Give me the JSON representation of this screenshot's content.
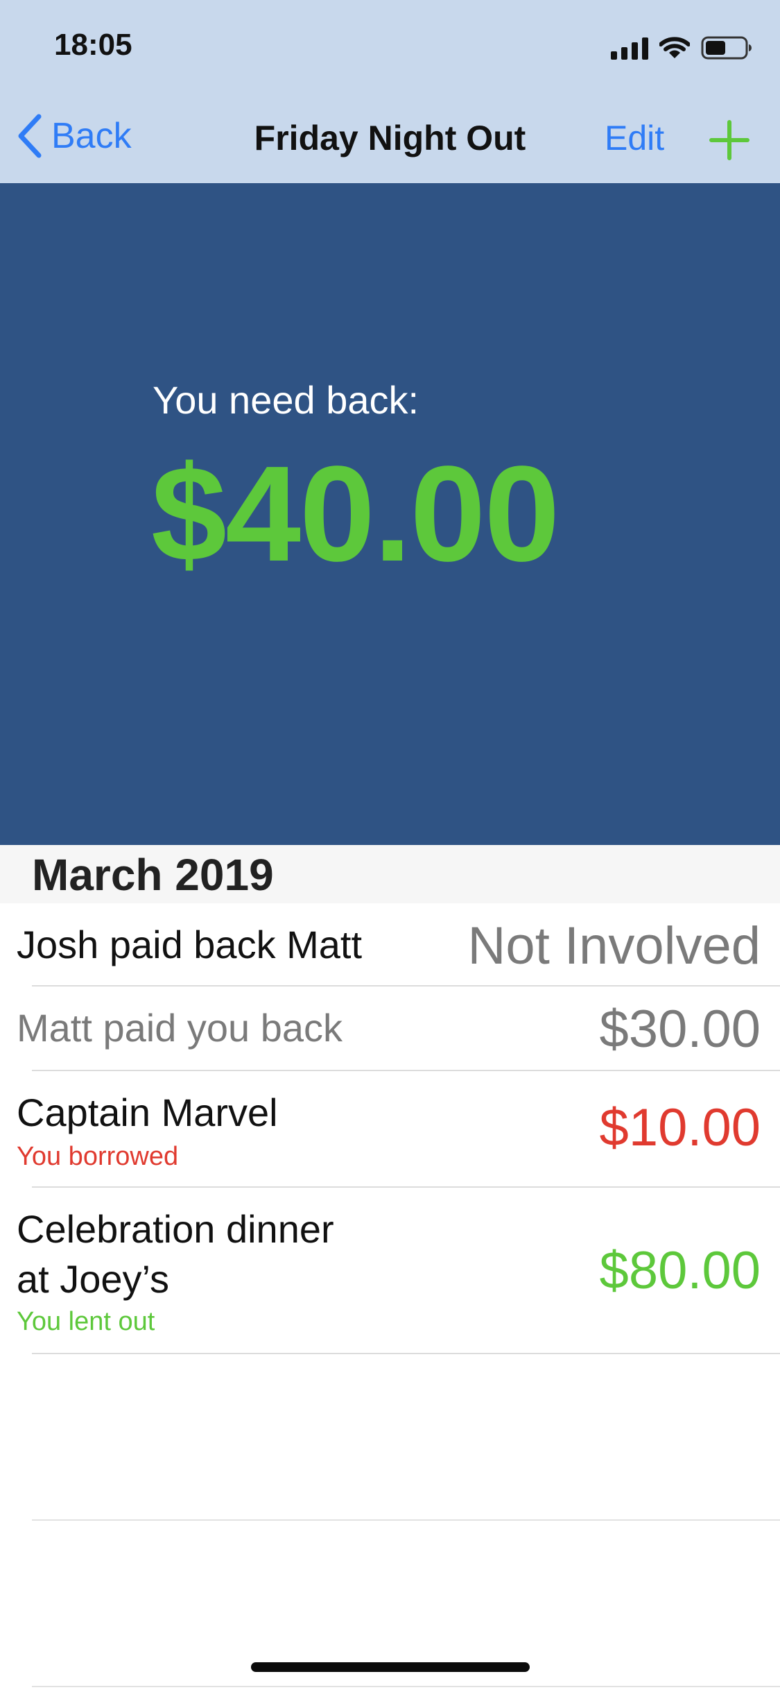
{
  "status": {
    "time": "18:05"
  },
  "nav": {
    "back_label": "Back",
    "title": "Friday Night Out",
    "edit_label": "Edit",
    "add_icon": "plus-icon"
  },
  "summary": {
    "label": "You need back:",
    "amount": "$40.00",
    "amount_color": "#5dc83b"
  },
  "section": {
    "title": "March 2019"
  },
  "transactions": [
    {
      "title": "Josh paid back Matt",
      "subtitle": "",
      "amount": "Not Involved",
      "style": "gray"
    },
    {
      "title": "Matt paid you back",
      "subtitle": "",
      "amount": "$30.00",
      "style": "gray"
    },
    {
      "title": "Captain Marvel",
      "subtitle": "You borrowed",
      "amount": "$10.00",
      "style": "red"
    },
    {
      "title_line1": "Celebration dinner",
      "title_line2": "at Joey’s",
      "subtitle": "You lent out",
      "amount": "$80.00",
      "style": "green"
    }
  ],
  "colors": {
    "nav_bg": "#c8d8ec",
    "hero_bg": "#2f5384",
    "accent_blue": "#2f7cf6",
    "positive_green": "#5dc83b",
    "negative_red": "#e03a2f"
  }
}
